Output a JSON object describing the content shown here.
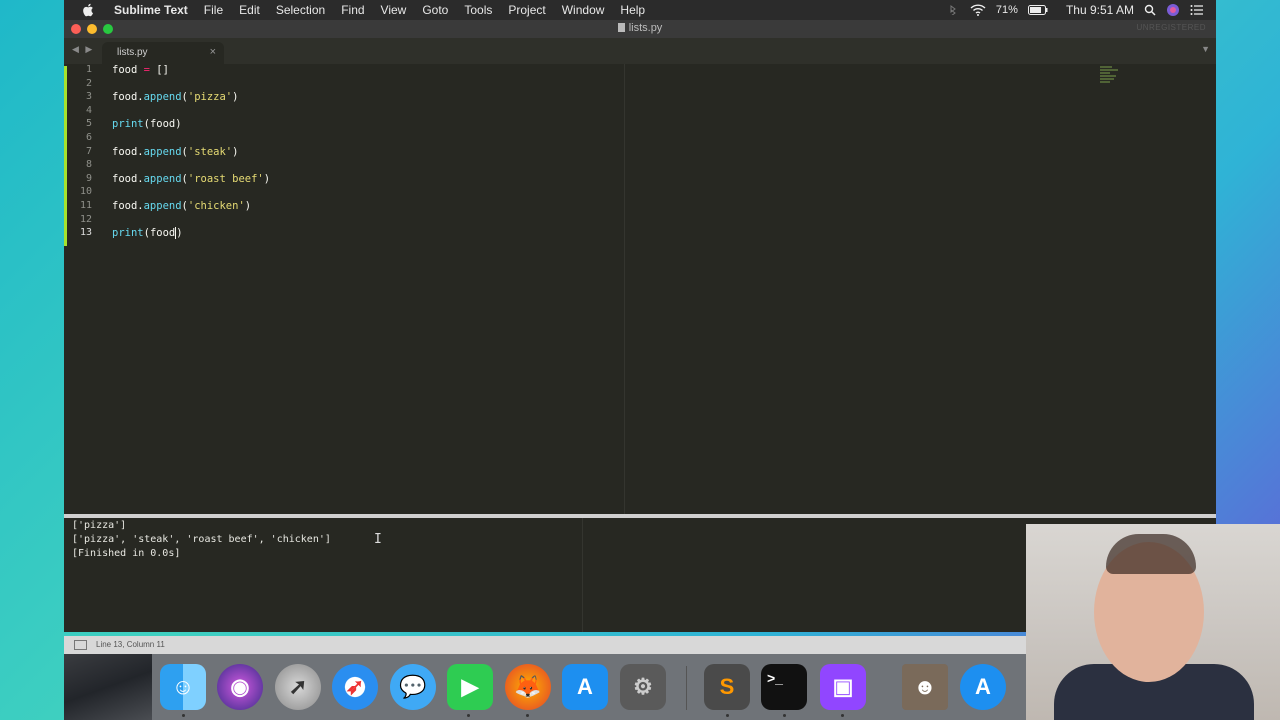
{
  "menubar": {
    "app_name": "Sublime Text",
    "items": [
      "File",
      "Edit",
      "Selection",
      "Find",
      "View",
      "Goto",
      "Tools",
      "Project",
      "Window",
      "Help"
    ],
    "battery": "71%",
    "clock": "Thu 9:51 AM"
  },
  "window": {
    "title": "lists.py",
    "unregistered": "UNREGISTERED",
    "tab_label": "lists.py"
  },
  "editor": {
    "line_numbers": [
      "1",
      "2",
      "3",
      "4",
      "5",
      "6",
      "7",
      "8",
      "9",
      "10",
      "11",
      "12",
      "13"
    ],
    "lines": [
      {
        "obj": "food",
        "op": " = ",
        "rest": "[]"
      },
      {},
      {
        "obj": "food.",
        "fn": "append",
        "open": "(",
        "str": "'pizza'",
        "close": ")"
      },
      {},
      {
        "fn": "print",
        "open": "(",
        "arg": "food",
        "close": ")"
      },
      {},
      {
        "obj": "food.",
        "fn": "append",
        "open": "(",
        "str": "'steak'",
        "close": ")"
      },
      {},
      {
        "obj": "food.",
        "fn": "append",
        "open": "(",
        "str": "'roast beef'",
        "close": ")"
      },
      {},
      {
        "obj": "food.",
        "fn": "append",
        "open": "(",
        "str": "'chicken'",
        "close": ")"
      },
      {},
      {
        "fn": "print",
        "open": "(",
        "arg": "food",
        "close": ")"
      }
    ]
  },
  "console": {
    "output": [
      "['pizza']",
      "['pizza', 'steak', 'roast beef', 'chicken']",
      "[Finished in 0.0s]"
    ]
  },
  "statusbar": {
    "position": "Line 13, Column 11"
  },
  "dock": {
    "apps": [
      "Finder",
      "Siri",
      "Launchpad",
      "Safari",
      "Messages",
      "FaceTime",
      "Firefox",
      "App Store",
      "System Preferences",
      "Sublime Text",
      "Terminal",
      "Twitch",
      "Photo",
      "App Store Connect"
    ]
  },
  "colors": {
    "editor_bg": "#272822",
    "keyword": "#66d9ef",
    "string": "#e6db74",
    "operator": "#f92672",
    "gutter_mark": "#a6e22e"
  }
}
